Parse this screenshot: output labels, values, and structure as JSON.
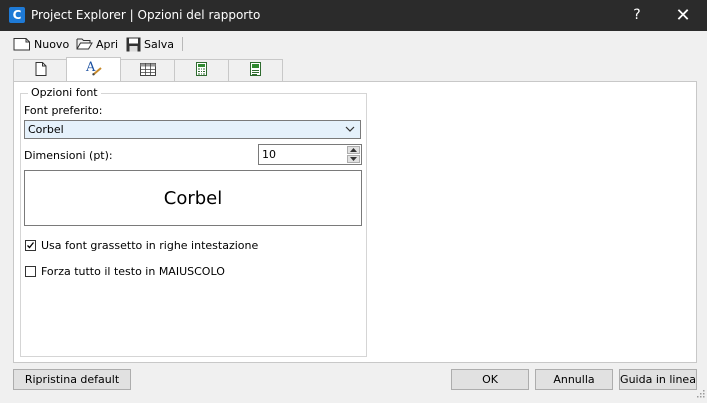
{
  "window": {
    "title": "Project Explorer | Opzioni del rapporto",
    "app_icon_letter": "C",
    "help_label": "?",
    "close_label": "✕"
  },
  "toolbar": {
    "new_label": "Nuovo",
    "open_label": "Apri",
    "save_label": "Salva"
  },
  "tabs": [
    {
      "icon": "page-icon"
    },
    {
      "icon": "font-icon",
      "active": true
    },
    {
      "icon": "table-icon"
    },
    {
      "icon": "calculator-icon"
    },
    {
      "icon": "document-green-icon"
    }
  ],
  "font_options": {
    "group_title": "Opzioni font",
    "preferred_font_label": "Font preferito:",
    "preferred_font_value": "Corbel",
    "size_label": "Dimensioni (pt):",
    "size_value": "10",
    "preview_text": "Corbel",
    "bold_header_label": "Usa font grassetto in righe intestazione",
    "bold_header_checked": true,
    "uppercase_label": "Forza tutto il testo in MAIUSCOLO",
    "uppercase_checked": false
  },
  "footer": {
    "reset_label": "Ripristina default",
    "ok_label": "OK",
    "cancel_label": "Annulla",
    "help_label": "Guida in linea"
  }
}
